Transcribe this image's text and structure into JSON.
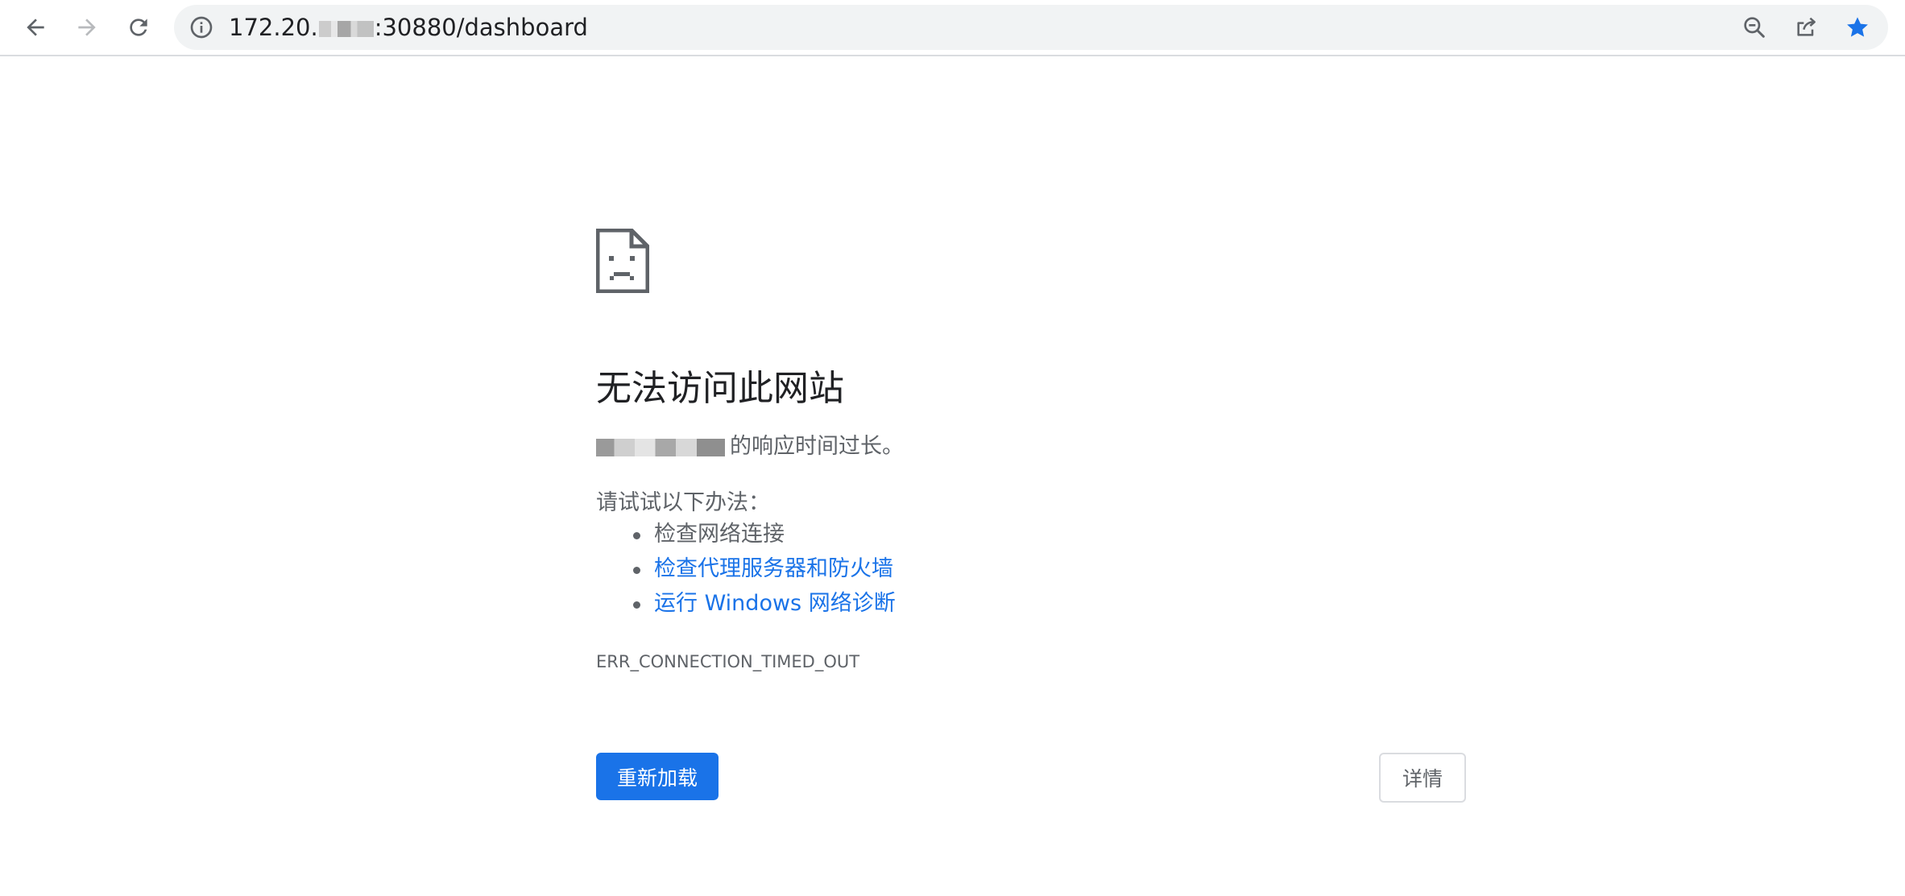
{
  "browser": {
    "url_prefix": "172.20.",
    "url_suffix": ":30880/dashboard",
    "url_redacted": true,
    "icons": {
      "back": "arrow-left-icon",
      "forward": "arrow-right-icon",
      "reload": "reload-icon",
      "info": "info-icon",
      "zoom": "zoom-out-icon",
      "share": "share-icon",
      "bookmark": "star-icon"
    },
    "bookmark_color": "#1a73e8"
  },
  "error_page": {
    "icon": "sad-page-icon",
    "heading": "无法访问此网站",
    "host_redacted": true,
    "summary_suffix": "的响应时间过长。",
    "try_label": "请试试以下办法：",
    "suggestions": [
      {
        "label": "检查网络连接",
        "link": false
      },
      {
        "label": "检查代理服务器和防火墙",
        "link": true
      },
      {
        "label": "运行 Windows 网络诊断",
        "link": true
      }
    ],
    "error_code": "ERR_CONNECTION_TIMED_OUT",
    "reload_button": "重新加载",
    "details_button": "详情",
    "accent_color": "#1a73e8"
  }
}
